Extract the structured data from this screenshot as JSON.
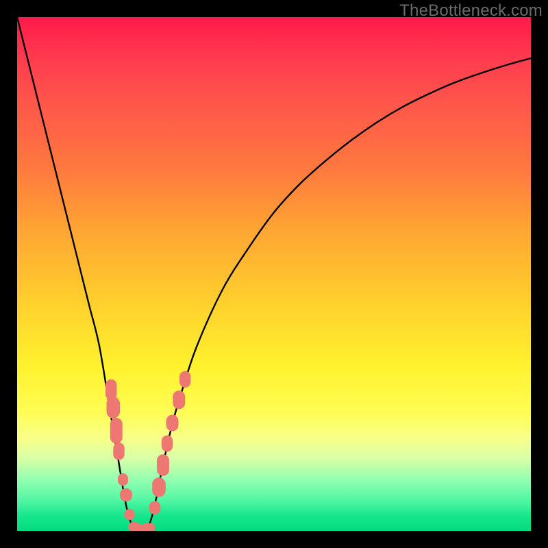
{
  "watermark": {
    "text": "TheBottleneck.com"
  },
  "colors": {
    "frame": "#000000",
    "curve_stroke": "#000000",
    "marker_fill": "#ed7872",
    "marker_stroke": "#ed7872"
  },
  "chart_data": {
    "type": "line",
    "title": "",
    "xlabel": "",
    "ylabel": "",
    "xlim": [
      0,
      100
    ],
    "ylim": [
      0,
      100
    ],
    "grid": false,
    "legend": false,
    "series": [
      {
        "name": "bottleneck-curve",
        "x": [
          0,
          2,
          4,
          6,
          8,
          10,
          12,
          14,
          16,
          18,
          19,
          20,
          21,
          22,
          23,
          24,
          25,
          26,
          27,
          28,
          30,
          32,
          35,
          40,
          45,
          50,
          55,
          60,
          65,
          70,
          75,
          80,
          85,
          90,
          95,
          100
        ],
        "y": [
          100,
          92,
          84,
          76,
          68,
          60,
          52,
          44,
          36,
          24,
          18,
          12,
          6,
          2,
          0,
          0,
          0,
          2,
          6,
          11,
          20,
          27,
          36,
          47,
          55,
          62,
          67.5,
          72,
          76,
          79.5,
          82.5,
          85,
          87.2,
          89,
          90.6,
          92
        ]
      }
    ],
    "markers": [
      {
        "name": "left-cluster",
        "shape": "rounded-rect",
        "points": [
          {
            "x": 18.3,
            "y": 27.5,
            "w": 2.2,
            "h": 4.0
          },
          {
            "x": 18.7,
            "y": 24.0,
            "w": 2.6,
            "h": 4.2
          },
          {
            "x": 19.3,
            "y": 19.5,
            "w": 2.4,
            "h": 5.0
          },
          {
            "x": 19.8,
            "y": 15.5,
            "w": 2.2,
            "h": 3.4
          },
          {
            "x": 20.6,
            "y": 10.0,
            "w": 2.0,
            "h": 2.4
          },
          {
            "x": 21.2,
            "y": 7.0,
            "w": 2.4,
            "h": 2.6
          },
          {
            "x": 21.9,
            "y": 3.2,
            "w": 2.0,
            "h": 2.2
          }
        ]
      },
      {
        "name": "bottom-cluster",
        "shape": "rounded-rect",
        "points": [
          {
            "x": 22.8,
            "y": 0.8,
            "w": 2.4,
            "h": 1.8
          },
          {
            "x": 24.2,
            "y": 0.4,
            "w": 2.6,
            "h": 1.8
          },
          {
            "x": 25.6,
            "y": 0.6,
            "w": 2.6,
            "h": 1.8
          }
        ]
      },
      {
        "name": "right-cluster",
        "shape": "rounded-rect",
        "points": [
          {
            "x": 26.8,
            "y": 4.5,
            "w": 2.2,
            "h": 2.6
          },
          {
            "x": 27.6,
            "y": 8.5,
            "w": 2.6,
            "h": 3.8
          },
          {
            "x": 28.4,
            "y": 12.8,
            "w": 2.4,
            "h": 4.2
          },
          {
            "x": 29.2,
            "y": 17.0,
            "w": 2.2,
            "h": 3.2
          },
          {
            "x": 30.2,
            "y": 21.0,
            "w": 2.4,
            "h": 3.2
          },
          {
            "x": 31.5,
            "y": 25.5,
            "w": 2.4,
            "h": 3.6
          },
          {
            "x": 32.7,
            "y": 29.5,
            "w": 2.2,
            "h": 3.2
          }
        ]
      }
    ],
    "gradient_stops": [
      {
        "pos": 0,
        "color": "#ff1a4a"
      },
      {
        "pos": 30,
        "color": "#ff7a3e"
      },
      {
        "pos": 56,
        "color": "#ffd12c"
      },
      {
        "pos": 77,
        "color": "#fffd55"
      },
      {
        "pos": 90,
        "color": "#93ffb1"
      },
      {
        "pos": 100,
        "color": "#00db7e"
      }
    ]
  }
}
